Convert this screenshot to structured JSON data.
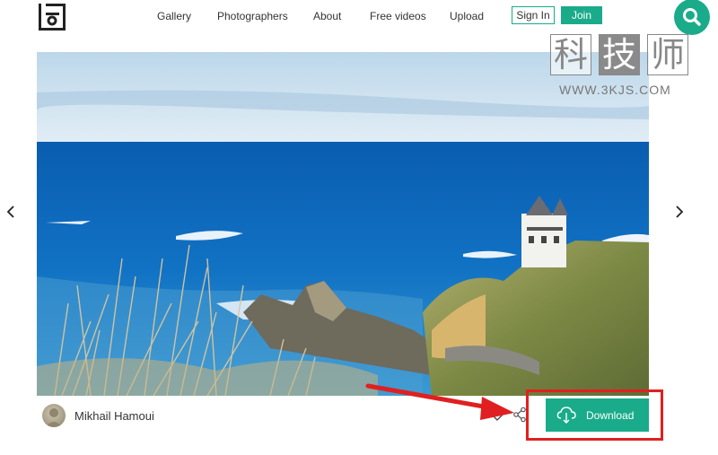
{
  "header": {
    "logo_icon": "site-logo-icon",
    "nav": [
      {
        "label": "Gallery"
      },
      {
        "label": "Photographers"
      },
      {
        "label": "About"
      },
      {
        "label": "Free videos"
      },
      {
        "label": "Upload"
      }
    ],
    "signin_label": "Sign In",
    "join_label": "Join",
    "search_icon": "search-icon",
    "accent_color": "#1aab8a"
  },
  "watermark": {
    "chars": [
      "科",
      "技",
      "师"
    ],
    "url": "WWW.3KJS.COM"
  },
  "photo": {
    "prev_icon": "chevron-left-icon",
    "next_icon": "chevron-right-icon"
  },
  "footer": {
    "author_name": "Mikhail Hamoui",
    "like_icon": "heart-icon",
    "share_icon": "share-icon",
    "download_label": "Download",
    "download_icon": "cloud-download-icon",
    "annotation_color": "#e02020"
  }
}
